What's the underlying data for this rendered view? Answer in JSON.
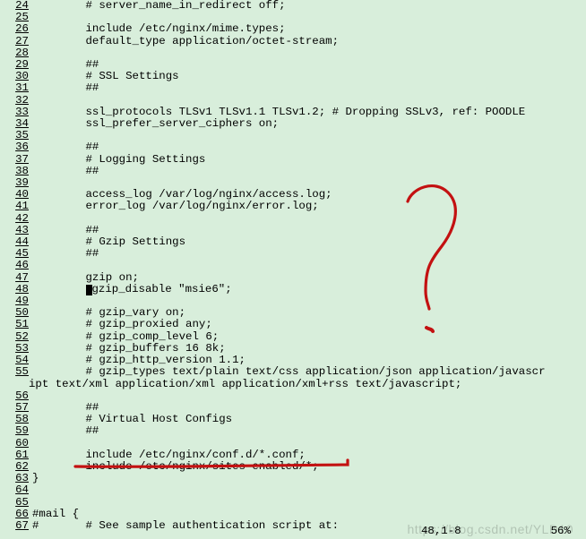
{
  "lines": [
    {
      "num": "24",
      "text": "        # server_name_in_redirect off;"
    },
    {
      "num": "25",
      "text": ""
    },
    {
      "num": "26",
      "text": "        include /etc/nginx/mime.types;"
    },
    {
      "num": "27",
      "text": "        default_type application/octet-stream;"
    },
    {
      "num": "28",
      "text": ""
    },
    {
      "num": "29",
      "text": "        ##"
    },
    {
      "num": "30",
      "text": "        # SSL Settings"
    },
    {
      "num": "31",
      "text": "        ##"
    },
    {
      "num": "32",
      "text": ""
    },
    {
      "num": "33",
      "text": "        ssl_protocols TLSv1 TLSv1.1 TLSv1.2; # Dropping SSLv3, ref: POODLE"
    },
    {
      "num": "34",
      "text": "        ssl_prefer_server_ciphers on;"
    },
    {
      "num": "35",
      "text": ""
    },
    {
      "num": "36",
      "text": "        ##"
    },
    {
      "num": "37",
      "text": "        # Logging Settings"
    },
    {
      "num": "38",
      "text": "        ##"
    },
    {
      "num": "39",
      "text": ""
    },
    {
      "num": "40",
      "text": "        access_log /var/log/nginx/access.log;"
    },
    {
      "num": "41",
      "text": "        error_log /var/log/nginx/error.log;"
    },
    {
      "num": "42",
      "text": ""
    },
    {
      "num": "43",
      "text": "        ##"
    },
    {
      "num": "44",
      "text": "        # Gzip Settings"
    },
    {
      "num": "45",
      "text": "        ##"
    },
    {
      "num": "46",
      "text": ""
    },
    {
      "num": "47",
      "text": "        gzip on;"
    },
    {
      "num": "48",
      "text": "gzip_disable \"msie6\";",
      "cursorPrefix": "        "
    },
    {
      "num": "49",
      "text": ""
    },
    {
      "num": "50",
      "text": "        # gzip_vary on;"
    },
    {
      "num": "51",
      "text": "        # gzip_proxied any;"
    },
    {
      "num": "52",
      "text": "        # gzip_comp_level 6;"
    },
    {
      "num": "53",
      "text": "        # gzip_buffers 16 8k;"
    },
    {
      "num": "54",
      "text": "        # gzip_http_version 1.1;"
    },
    {
      "num": "55",
      "text": "        # gzip_types text/plain text/css application/json application/javascr"
    },
    {
      "num": "",
      "text": "ipt text/xml application/xml application/xml+rss text/javascript;",
      "wrap": true
    },
    {
      "num": "56",
      "text": ""
    },
    {
      "num": "57",
      "text": "        ##"
    },
    {
      "num": "58",
      "text": "        # Virtual Host Configs"
    },
    {
      "num": "59",
      "text": "        ##"
    },
    {
      "num": "60",
      "text": ""
    },
    {
      "num": "61",
      "text": "        include /etc/nginx/conf.d/*.conf;"
    },
    {
      "num": "62",
      "text": "        include /etc/nginx/sites-enabled/*;"
    },
    {
      "num": "63",
      "text": "}"
    },
    {
      "num": "64",
      "text": ""
    },
    {
      "num": "65",
      "text": ""
    },
    {
      "num": "66",
      "text": "#mail {"
    },
    {
      "num": "67",
      "text": "#       # See sample authentication script at:"
    }
  ],
  "status": {
    "pos": "48,1-8",
    "pct": "56%"
  },
  "watermark": "https://blog.csdn.net/YLD10"
}
